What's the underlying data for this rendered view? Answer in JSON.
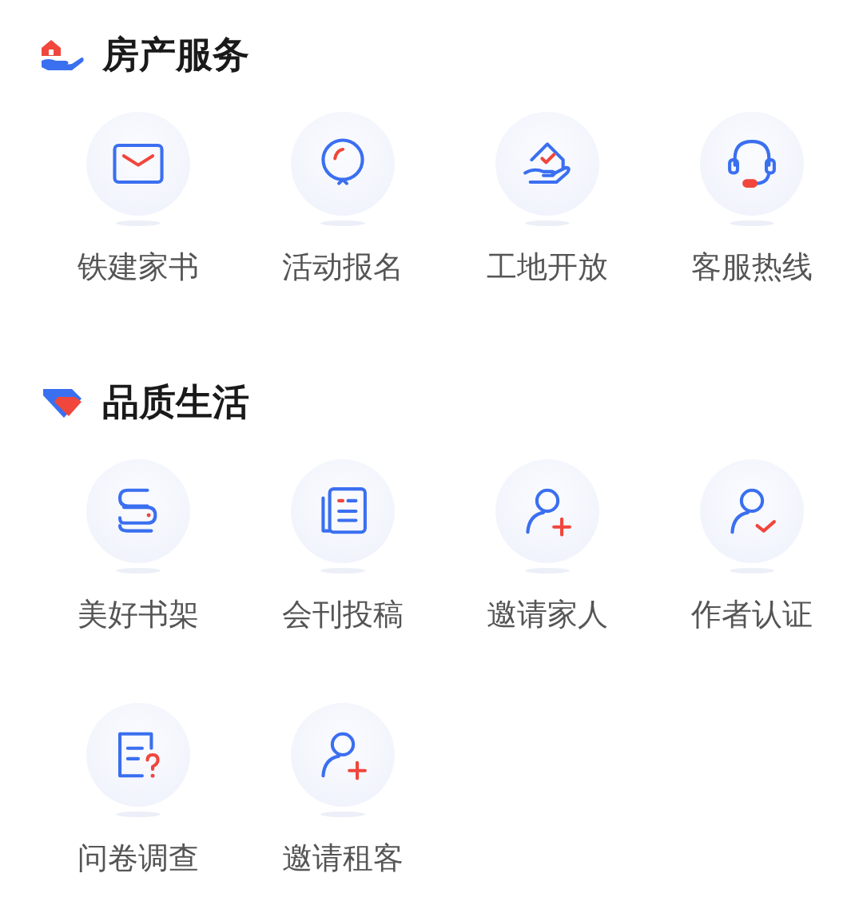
{
  "sections": [
    {
      "title": "房产服务",
      "items": [
        {
          "label": "铁建家书"
        },
        {
          "label": "活动报名"
        },
        {
          "label": "工地开放"
        },
        {
          "label": "客服热线"
        }
      ]
    },
    {
      "title": "品质生活",
      "items": [
        {
          "label": "美好书架"
        },
        {
          "label": "会刊投稿"
        },
        {
          "label": "邀请家人"
        },
        {
          "label": "作者认证"
        },
        {
          "label": "问卷调查"
        },
        {
          "label": "邀请租客"
        }
      ]
    }
  ]
}
